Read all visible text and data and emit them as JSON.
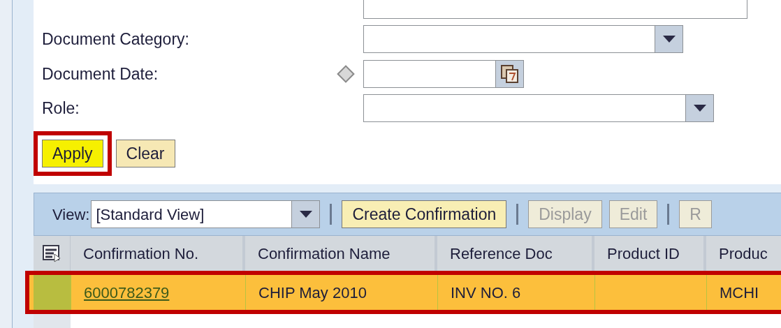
{
  "form": {
    "fields": [
      {
        "kind": "text",
        "required": false
      },
      {
        "label": "Document Category:",
        "kind": "dropdown",
        "required": false
      },
      {
        "label": "Document Date:",
        "kind": "date",
        "required": true
      },
      {
        "label": "Role:",
        "kind": "dropdown",
        "required": false
      }
    ],
    "buttons": [
      {
        "label": "Apply",
        "highlighted": true,
        "primary": true
      },
      {
        "label": "Clear",
        "highlighted": false,
        "primary": false
      }
    ]
  },
  "table": {
    "view_label": "View:",
    "view_value": "[Standard View]",
    "toolbar": [
      {
        "label": "Create Confirmation",
        "disabled": false
      },
      {
        "label": "Display",
        "disabled": true
      },
      {
        "label": "Edit",
        "disabled": true
      },
      {
        "label": "R",
        "disabled": true
      }
    ],
    "columns": [
      "Confirmation No.",
      "Confirmation Name",
      "Reference Doc",
      "Product ID",
      "Produc"
    ],
    "rows": [
      {
        "selected": true,
        "highlighted": true,
        "cells": [
          "6000782379",
          "CHIP May 2010",
          "INV NO. 6",
          "",
          "MCHI"
        ]
      }
    ]
  }
}
